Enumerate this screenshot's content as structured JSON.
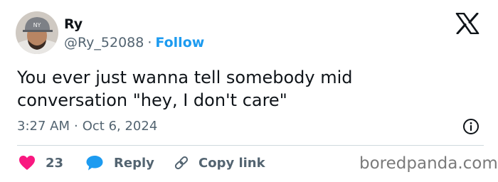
{
  "author": {
    "display_name": "Ry",
    "handle": "@Ry_52088",
    "separator": "·",
    "follow_label": "Follow",
    "avatar_icon": "user-avatar-photo"
  },
  "tweet": {
    "text": "You ever just wanna tell somebody mid\nconversation \"hey, I don't care\"",
    "time": "3:27 AM",
    "separator": "·",
    "date": "Oct 6, 2024"
  },
  "actions": {
    "like_count": "23",
    "like_icon": "heart-icon",
    "reply_label": "Reply",
    "reply_icon": "speech-bubble-icon",
    "copy_label": "Copy link",
    "copy_icon": "link-icon",
    "info_icon": "info-circle-icon"
  },
  "brand": {
    "platform_icon": "x-logo-icon",
    "watermark": "boredpanda.com"
  },
  "colors": {
    "accent": "#1d9bf0",
    "heart": "#f91880",
    "text": "#0f1419",
    "muted": "#536471",
    "divider": "#cfd9de"
  }
}
